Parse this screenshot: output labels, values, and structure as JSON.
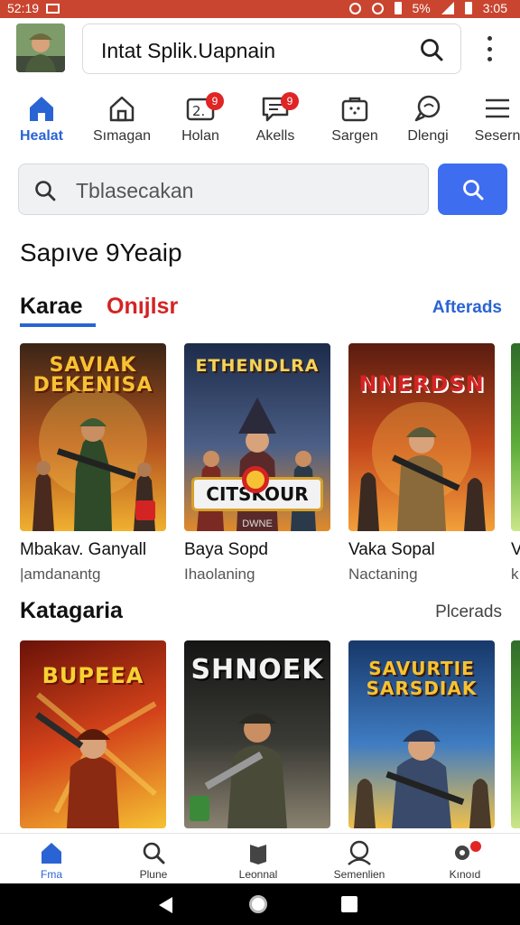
{
  "status_bar": {
    "time_left": "52:19",
    "battery_text": "5%",
    "time_right": "3:05"
  },
  "header": {
    "url": "Intat Splik.Uapnain",
    "avatar_icon": "avatar-soldier-icon",
    "menu_icon": "more-vert-icon"
  },
  "top_nav": {
    "items": [
      {
        "label": "Healat",
        "icon": "home-icon",
        "active": true
      },
      {
        "label": "Sımagan",
        "icon": "house-outline-icon"
      },
      {
        "label": "Holan",
        "icon": "counter-icon",
        "badge": "9"
      },
      {
        "label": "Akells",
        "icon": "chat-icon",
        "badge": "9"
      },
      {
        "label": "Sargen",
        "icon": "bag-icon"
      },
      {
        "label": "Dlengi",
        "icon": "message-icon"
      },
      {
        "label": "Sesern",
        "icon": "menu-icon"
      }
    ]
  },
  "search": {
    "placeholder": "Tblasecakan"
  },
  "page_title": "Sapıve 9Yeaip",
  "section1": {
    "tab_active": "Karae",
    "tab_other": "Onıjlsr",
    "link": "Afterads",
    "cards": [
      {
        "title": "Mbakav. Ganyall",
        "subtitle": "|amdanantg",
        "art_title": "SAVIAK DEKENISA",
        "art_colors": [
          "#3a2416",
          "#b5541f",
          "#f0b030"
        ]
      },
      {
        "title": "Baya Sopd",
        "subtitle": "Ihaolaning",
        "art_title": "ETHENDLRA",
        "art_badge": "CITSKOUR",
        "art_badge_sub": "DWNE",
        "art_colors": [
          "#1c2b4a",
          "#4c5f86",
          "#e08a2a"
        ]
      },
      {
        "title": "Vaka Sopal",
        "subtitle": "Nactaning",
        "art_title": "NNERDSN",
        "art_colors": [
          "#5a1c10",
          "#c4471c",
          "#f2a03a"
        ]
      },
      {
        "title": "V",
        "subtitle": "k",
        "art_colors": [
          "#2f6c2a",
          "#5fae3a",
          "#cbe68a"
        ]
      }
    ]
  },
  "section2": {
    "title": "Katagaria",
    "link": "Plcerads",
    "cards": [
      {
        "art_title": "BUPEEA",
        "art_colors": [
          "#6a1208",
          "#d3421a",
          "#f6c232"
        ]
      },
      {
        "art_title": "SHNOEK",
        "art_colors": [
          "#151515",
          "#3b3b36",
          "#8a8270"
        ]
      },
      {
        "art_title": "SAVURTIE SARSDIAK",
        "art_colors": [
          "#17386a",
          "#3f7cc2",
          "#f0c04a"
        ]
      },
      {
        "art_title": "",
        "art_colors": [
          "#2f6c2a",
          "#5fae3a",
          "#cbe68a"
        ]
      }
    ]
  },
  "bottom_nav": {
    "items": [
      {
        "label": "Fma",
        "icon": "home-icon",
        "active": true
      },
      {
        "label": "Plune",
        "icon": "search-icon"
      },
      {
        "label": "Leonnal",
        "icon": "library-icon"
      },
      {
        "label": "Semenlien",
        "icon": "profile-icon"
      },
      {
        "label": "Kınoıd",
        "icon": "settings-icon",
        "badge": true
      }
    ]
  }
}
